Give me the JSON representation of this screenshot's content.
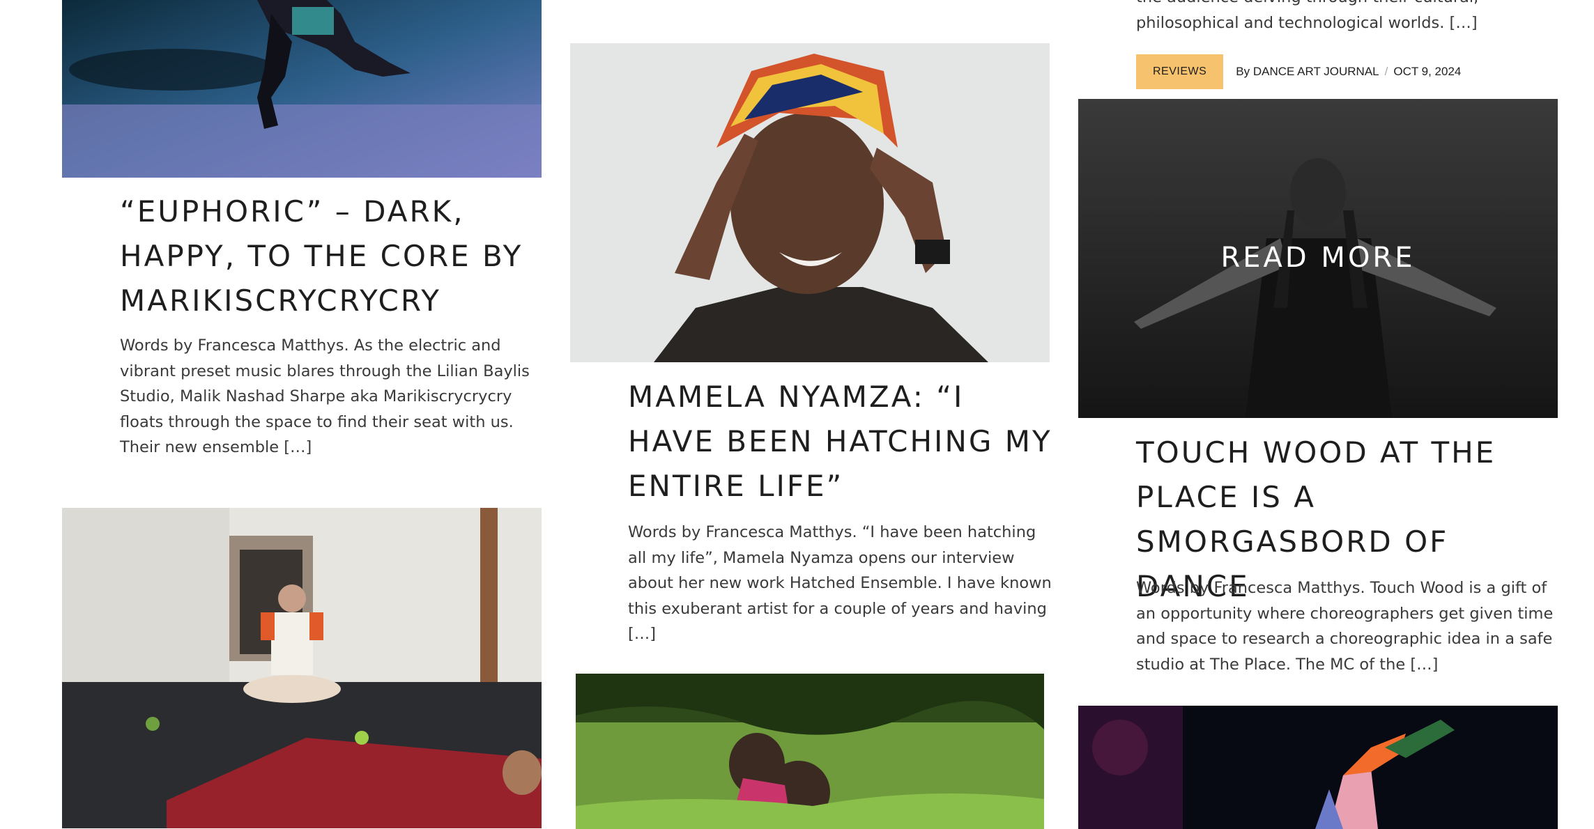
{
  "posts": [
    {
      "title": "“EUPHORIC” – DARK, HAPPY, TO THE CORE BY MARIKISCRYCRYCRY",
      "excerpt": "Words by Francesca Matthys. As the electric and vibrant preset music blares through the Lilian Baylis Studio, Malik Nashad Sharpe aka Marikiscrycrycry floats through the space to find their seat with us. Their new ensemble […]"
    },
    {
      "title": "MAMELA NYAMZA: “I HAVE BEEN HATCHING MY ENTIRE LIFE”",
      "excerpt": "Words by Francesca Matthys. “I have been hatching all my life”, Mamela Nyamza opens our interview about her new work Hatched Ensemble. I have known this exuberant artist for a couple of years and having […]"
    },
    {
      "excerpt_tail": "the audience delving through their cultural, philosophical and technological worlds. […]",
      "category": "REVIEWS",
      "by": "By",
      "author": "DANCE ART JOURNAL",
      "separator": "/",
      "date": "OCT 9, 2024",
      "overlay": "READ MORE",
      "title": "TOUCH WOOD AT THE PLACE IS A SMORGASBORD OF DANCE",
      "excerpt": "Words by Francesca Matthys. Touch Wood is a gift of an opportunity where choreographers get given time and space to research a choreographic idea in a safe studio at The Place. The MC of the […]"
    }
  ],
  "colors": {
    "badge": "#f7c26d",
    "text": "#1e1e1e"
  }
}
